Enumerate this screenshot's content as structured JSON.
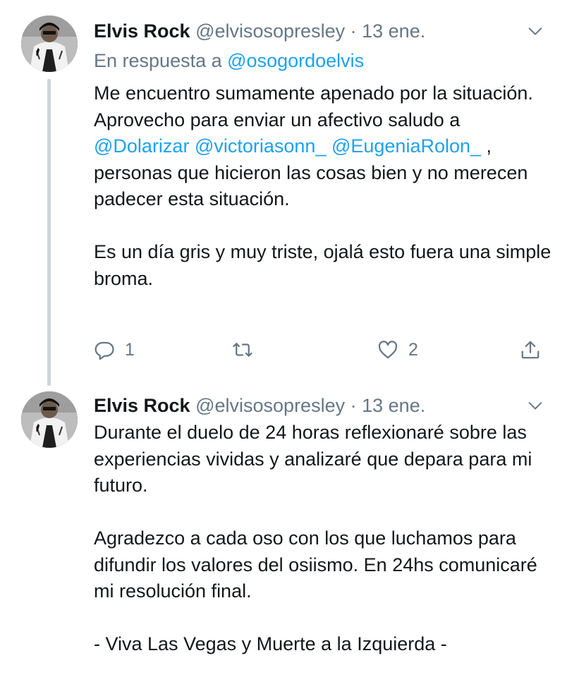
{
  "tweets": [
    {
      "name": "Elvis Rock",
      "handle": "@elvisosopresley",
      "separator": "·",
      "date": "13 ene.",
      "reply_prefix": "En respuesta a",
      "reply_to": "@osogordoelvis",
      "para1": {
        "t1": "Me encuentro sumamente apenado por la situación. Aprovecho para enviar un afectivo saludo a ",
        "m1": "@Dolarizar",
        "t2": " ",
        "m2": "@victoriasonn_",
        "t3": " ",
        "m3": "@EugeniaRolon_",
        "t4": " , personas que hicieron las cosas bien y no merecen padecer esta situación."
      },
      "para2": "Es un día gris y muy triste, ojalá esto fuera una simple broma.",
      "actions": {
        "reply_count": "1",
        "like_count": "2"
      }
    },
    {
      "name": "Elvis Rock",
      "handle": "@elvisosopresley",
      "separator": "·",
      "date": "13 ene.",
      "para1": "Durante el duelo de 24 horas reflexionaré sobre las experiencias vividas y analizaré que depara para mi futuro.",
      "para2": "Agradezco a cada oso con los que luchamos para difundir los valores del osiismo. En 24hs comunicaré mi resolución final.",
      "para3": "- Viva Las Vegas y Muerte a la Izquierda -"
    }
  ],
  "icons": {
    "caret": "chevron-down-icon",
    "reply": "reply-icon",
    "retweet": "retweet-icon",
    "like": "heart-icon",
    "share": "share-icon"
  },
  "colors": {
    "text": "#14171a",
    "secondary": "#657786",
    "link": "#1da1f2",
    "thread_line": "#ccd6dd"
  }
}
